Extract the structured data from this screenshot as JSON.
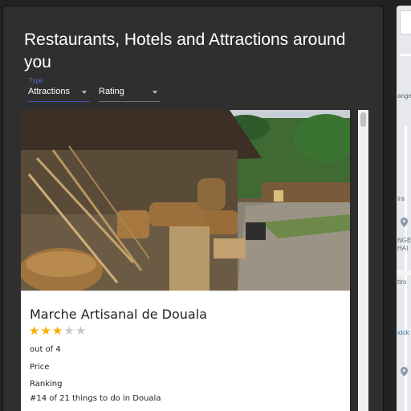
{
  "header": {
    "title": "Restaurants, Hotels and Attractions around you"
  },
  "filters": {
    "type_label": "Type",
    "type_value": "Attractions",
    "rating_value": "Rating"
  },
  "places": [
    {
      "name": "Marche Artisanal de Douala",
      "rating": 3,
      "rating_max": 5,
      "rating_text": "out of 4",
      "price_label": "Price",
      "ranking_label": "Ranking",
      "ranking_value": "#14 of 21 things to do in Douala"
    }
  ],
  "map": {
    "labels": [
      "ange",
      "ira",
      "NGE",
      "HAI",
      "ttro",
      "idok"
    ]
  },
  "icons": {
    "select_arrow": "dropdown-arrow-icon",
    "star": "star-icon",
    "map_pin": "map-pin-icon"
  },
  "colors": {
    "panel": "#2f2f2f",
    "accent": "#3f51b5",
    "star": "#faaf00"
  }
}
